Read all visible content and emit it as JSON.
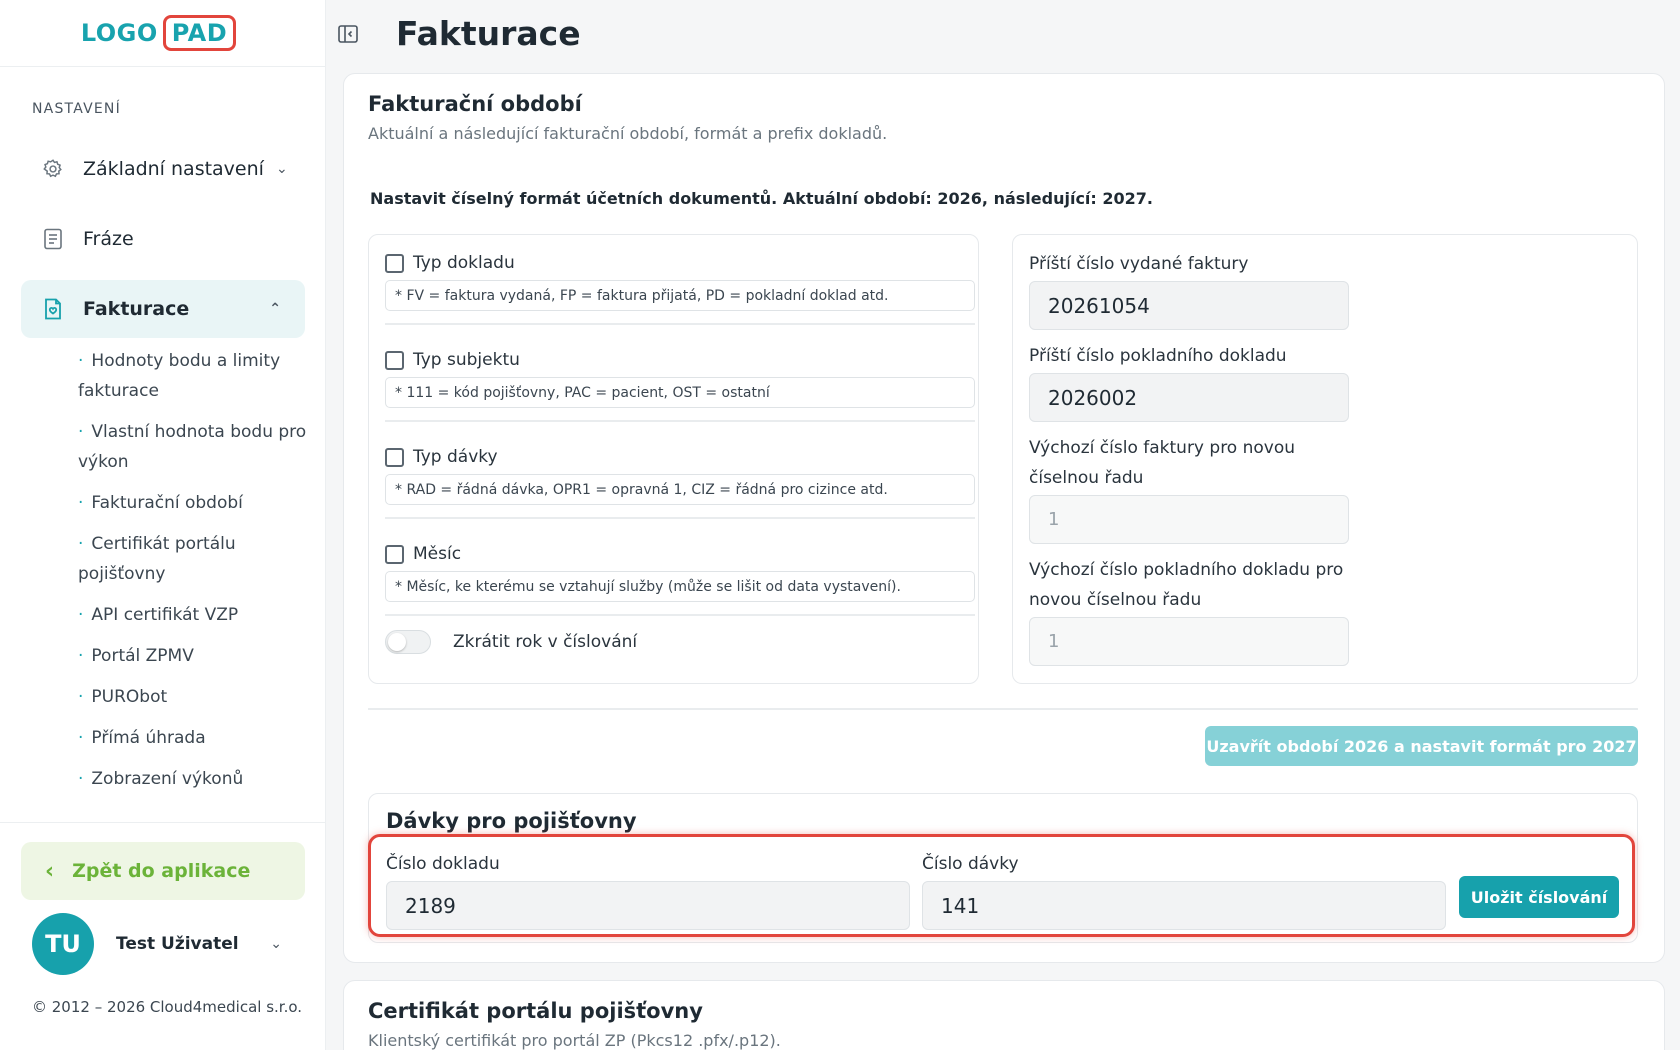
{
  "logo": {
    "part1": "LOGO",
    "part2": "PAD"
  },
  "sidebar": {
    "section": "NASTAVENÍ",
    "items": [
      {
        "label": "Základní nastavení",
        "icon": "gear-icon"
      },
      {
        "label": "Fráze",
        "icon": "document-icon"
      },
      {
        "label": "Fakturace",
        "icon": "invoice-icon"
      }
    ],
    "subitems": [
      "Hodnoty bodu a limity fakturace",
      "Vlastní hodnota bodu pro výkon",
      "Fakturační období",
      "Certifikát portálu pojišťovny",
      "API certifikát VZP",
      "Portál ZPMV",
      "PURObot",
      "Přímá úhrada",
      "Zobrazení výkonů"
    ],
    "back": "Zpět do aplikace",
    "user": {
      "initials": "TU",
      "name": "Test Uživatel"
    },
    "copyright": "© 2012 – 2026 Cloud4medical s.r.o."
  },
  "header": {
    "title": "Fakturace"
  },
  "period": {
    "title": "Fakturační období",
    "subtitle": "Aktuální a následující fakturační období, formát a prefix dokladů.",
    "intro": "Nastavit číselný formát účetních dokumentů. Aktuální období: 2026, následující: 2027.",
    "options": [
      {
        "label": "Typ dokladu",
        "hint": "* FV = faktura vydaná, FP = faktura přijatá, PD = pokladní doklad atd.",
        "checked": false
      },
      {
        "label": "Typ subjektu",
        "hint": "* 111 = kód pojišťovny, PAC = pacient, OST = ostatní",
        "checked": false
      },
      {
        "label": "Typ dávky",
        "hint": "* RAD = řádná dávka, OPR1 = opravná 1, CIZ = řádná pro cizince atd.",
        "checked": false
      },
      {
        "label": "Měsíc",
        "hint": "* Měsíc, ke kterému se vztahují služby (může se lišit od data vystavení).",
        "checked": false
      }
    ],
    "toggle_label": "Zkrátit rok v číslování",
    "toggle_on": false,
    "fields": {
      "next_invoice_label": "Příští číslo vydané faktury",
      "next_invoice_value": "20261054",
      "next_cash_label": "Příští číslo pokladního dokladu",
      "next_cash_value": "2026002",
      "default_invoice_label_1": "Výchozí číslo faktury pro novou",
      "default_invoice_label_2": "číselnou řadu",
      "default_invoice_value": "1",
      "default_cash_label_1": "Výchozí číslo pokladního dokladu pro",
      "default_cash_label_2": "novou číselnou řadu",
      "default_cash_value": "1"
    },
    "close_button": "Uzavřít období 2026 a nastavit formát pro 2027"
  },
  "batches": {
    "title": "Dávky pro pojišťovny",
    "doc_label": "Číslo dokladu",
    "doc_value": "2189",
    "batch_label": "Číslo dávky",
    "batch_value": "141",
    "save_button": "Uložit číslování"
  },
  "certificate": {
    "title": "Certifikát portálu pojišťovny",
    "subtitle": "Klientský certifikát pro portál ZP (Pkcs12 .pfx/.p12)."
  },
  "colors": {
    "accent": "#17a1ac",
    "highlight": "#e2453c",
    "back": "#6bb339"
  }
}
